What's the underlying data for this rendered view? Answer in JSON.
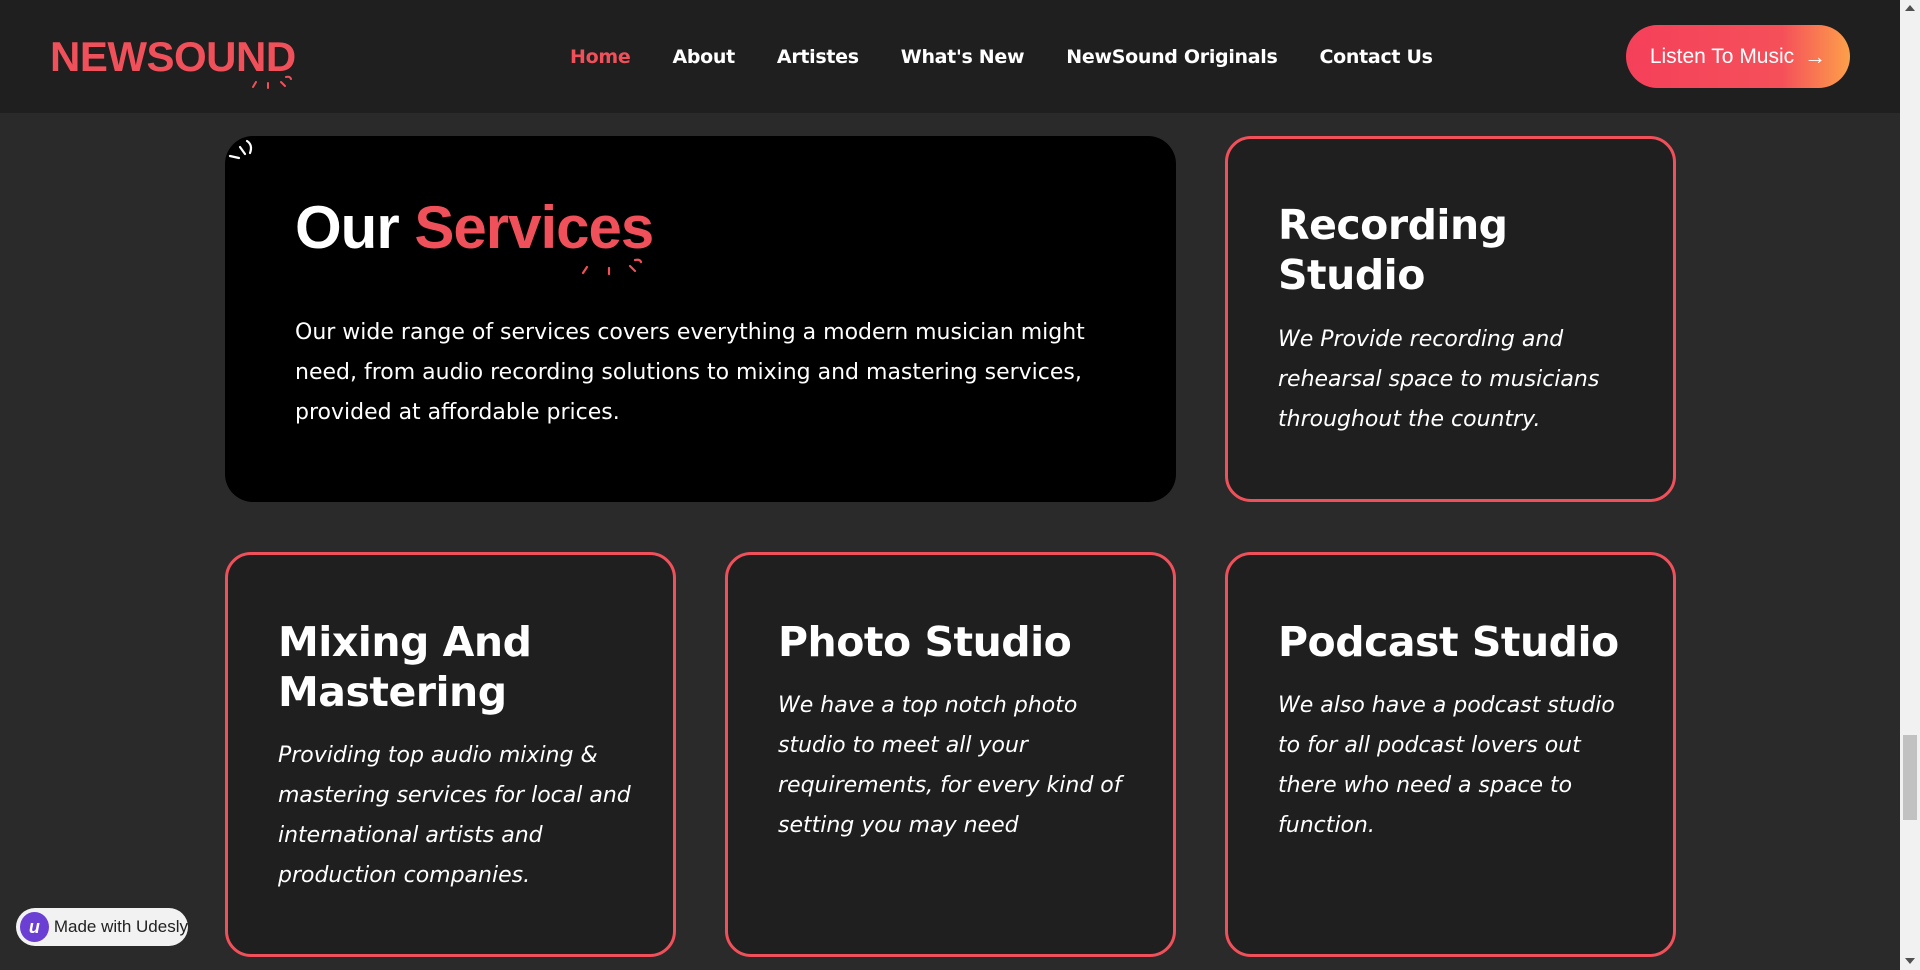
{
  "brand": {
    "logo": "NEWSOUND",
    "accent": "#f0505a"
  },
  "nav": {
    "items": [
      {
        "label": "Home",
        "active": true
      },
      {
        "label": "About",
        "active": false
      },
      {
        "label": "Artistes",
        "active": false
      },
      {
        "label": "What's New",
        "active": false
      },
      {
        "label": "NewSound Originals",
        "active": false
      },
      {
        "label": "Contact Us",
        "active": false
      }
    ],
    "cta": {
      "label": "Listen To Music",
      "icon": "arrow-right-icon"
    }
  },
  "intro": {
    "title_plain": "Our",
    "title_accent": "Services",
    "text": "Our wide range of services covers everything a modern musician might need, from audio recording solutions to mixing and mastering services, provided at affordable prices."
  },
  "services": [
    {
      "title": "Recording Studio",
      "desc": "We Provide recording and rehearsal space to musicians throughout the country."
    },
    {
      "title": "Mixing And Mastering",
      "desc": "Providing top audio mixing & mastering services for local and international artists and production companies."
    },
    {
      "title": "Photo Studio",
      "desc": "We have a top notch photo studio to meet all your requirements, for every kind of setting you may need"
    },
    {
      "title": "Podcast Studio",
      "desc": "We also have a podcast studio to for all podcast lovers out there who need a space to function."
    }
  ],
  "badge": {
    "icon_letter": "u",
    "label": "Made with Udesly"
  }
}
